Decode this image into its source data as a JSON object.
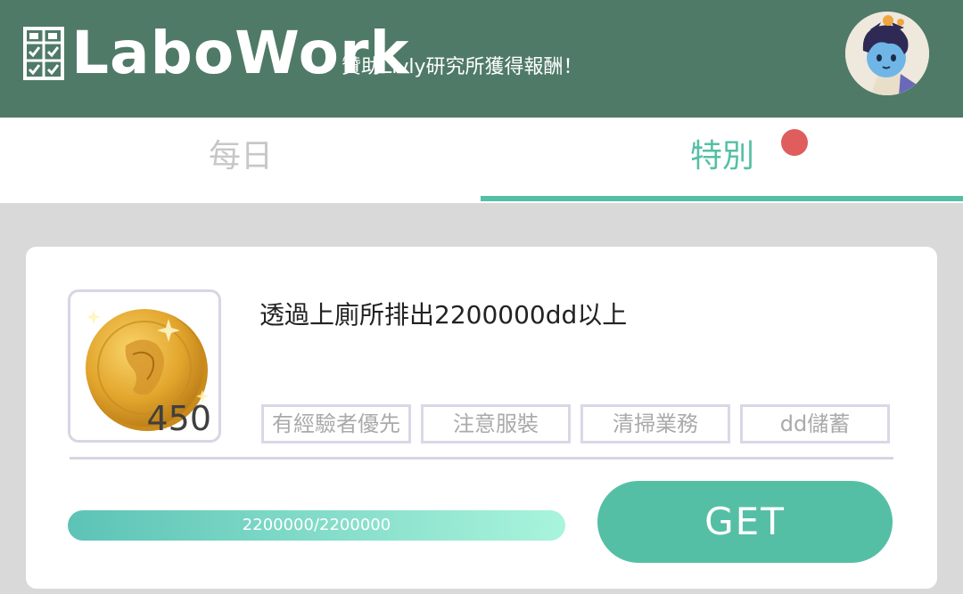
{
  "header": {
    "logo_text": "LaboWork",
    "tagline": "贊助Livly研究所獲得報酬！",
    "logo_icon": "checklist-icon",
    "avatar_icon": "avatar"
  },
  "tabs": [
    {
      "label": "每日",
      "active": false
    },
    {
      "label": "特別",
      "active": true,
      "has_notification": true
    }
  ],
  "task": {
    "title": "透過上廁所排出2200000dd以上",
    "reward": {
      "icon": "gold-coin-icon",
      "count": "450"
    },
    "tags": [
      "有經驗者優先",
      "注意服裝",
      "清掃業務",
      "dd儲蓄"
    ],
    "progress": {
      "current": 2200000,
      "total": 2200000,
      "text": "2200000/2200000",
      "fraction": 1.0
    },
    "button_label": "GET"
  },
  "colors": {
    "header_bg": "#4f7a67",
    "accent": "#55bfa6",
    "notification": "#e05d5d",
    "page_bg": "#d9d9d9"
  }
}
